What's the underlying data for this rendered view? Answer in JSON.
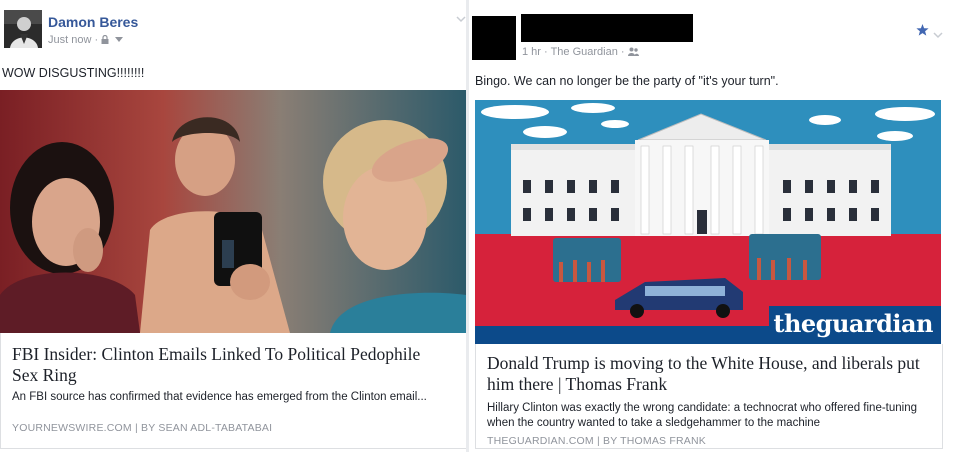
{
  "left_post": {
    "author": "Damon Beres",
    "timestamp": "Just now",
    "privacy_icon": "lock-icon",
    "text": "WOW DISGUSTING!!!!!!!!",
    "link": {
      "title": "FBI Insider: Clinton Emails Linked To Political Pedophile Sex Ring",
      "description": "An FBI source has confirmed that evidence has emerged from the Clinton email...",
      "source": "YOURNEWSWIRE.COM | BY SEAN ADL-TABATABAI"
    }
  },
  "right_post": {
    "author": "",
    "timestamp": "1 hr",
    "page": "The Guardian",
    "audience_icon": "friends-icon",
    "text": "Bingo. We can no longer be the party of \"it's your turn\".",
    "link": {
      "image_logo": "theguardian",
      "title": "Donald Trump is moving to the White House, and liberals put him there | Thomas Frank",
      "description": "Hillary Clinton was exactly the wrong candidate: a technocrat who offered fine-tuning when the country wanted to take a sledgehammer to the machine",
      "source": "THEGUARDIAN.COM | BY THOMAS FRANK"
    }
  },
  "colors": {
    "link_blue": "#365899",
    "meta_gray": "#90949c",
    "guardian_blue": "#0c4a8a"
  }
}
